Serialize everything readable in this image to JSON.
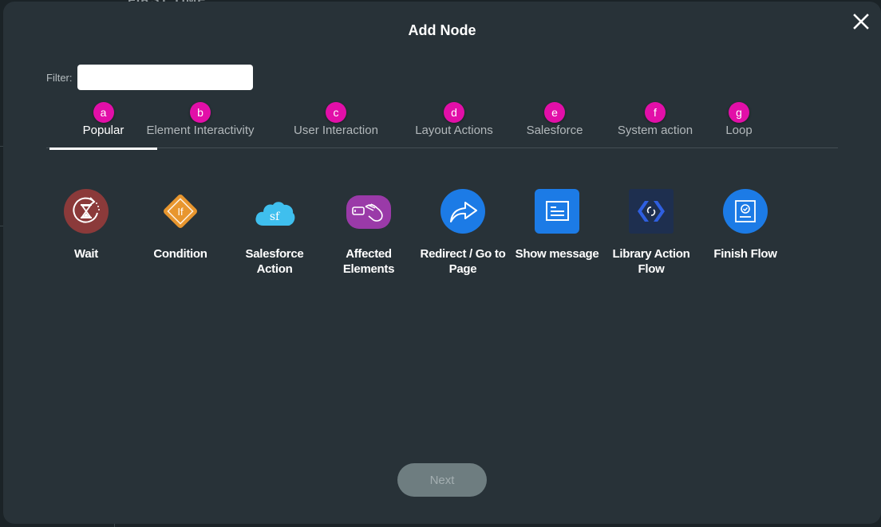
{
  "background": {
    "peek_text": "FIRST TIME"
  },
  "dialog": {
    "title": "Add Node",
    "close_icon": "close-icon",
    "filter": {
      "label": "Filter:",
      "value": "",
      "placeholder": ""
    },
    "tabs": [
      {
        "badge": "a",
        "label": "Popular",
        "active": true
      },
      {
        "badge": "b",
        "label": "Element Interactivity",
        "active": false
      },
      {
        "badge": "c",
        "label": "User Interaction",
        "active": false
      },
      {
        "badge": "d",
        "label": "Layout Actions",
        "active": false
      },
      {
        "badge": "e",
        "label": "Salesforce",
        "active": false
      },
      {
        "badge": "f",
        "label": "System action",
        "active": false
      },
      {
        "badge": "g",
        "label": "Loop",
        "active": false
      }
    ],
    "nodes": [
      {
        "label": "Wait",
        "icon": "hourglass-icon",
        "color": "#8b3a3a"
      },
      {
        "label": "Condition",
        "icon": "if-diamond-icon",
        "color": "#e8962e"
      },
      {
        "label": "Salesforce Action",
        "icon": "salesforce-cloud-icon",
        "color": "#3fbfee"
      },
      {
        "label": "Affected Elements",
        "icon": "hand-pointer-icon",
        "color": "#9a3aa8"
      },
      {
        "label": "Redirect / Go to Page",
        "icon": "share-arrow-icon",
        "color": "#1c7be6"
      },
      {
        "label": "Show message",
        "icon": "message-icon",
        "color": "#1c7be6"
      },
      {
        "label": "Library Action Flow",
        "icon": "library-code-icon",
        "color": "#1e2f4f"
      },
      {
        "label": "Finish Flow",
        "icon": "finish-check-icon",
        "color": "#1c7be6"
      }
    ],
    "next_button": "Next"
  },
  "colors": {
    "modal_bg": "#283238",
    "badge": "#e20fa8",
    "next_disabled": "#6e7d80"
  }
}
